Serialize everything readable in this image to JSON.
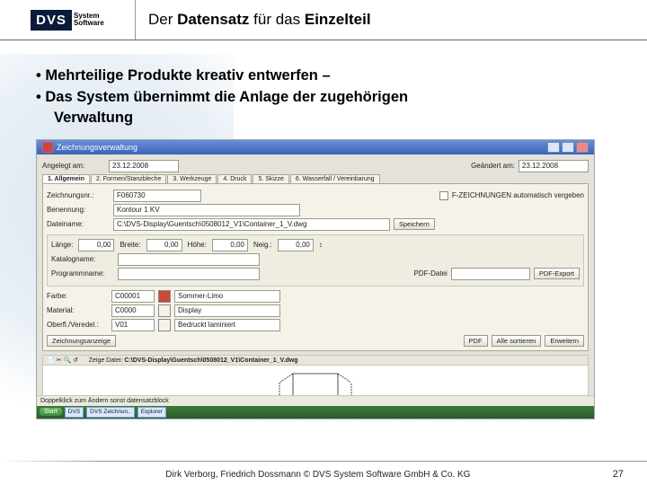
{
  "logo": {
    "brand": "DVS",
    "sub1": "System",
    "sub2": "Software"
  },
  "slide": {
    "title_pre": "Der ",
    "title_bold": "Datensatz",
    "title_post": " für das ",
    "title_bold2": "Einzelteil"
  },
  "bullets": {
    "b1": "Mehrteilige Produkte kreativ entwerfen –",
    "b2": "Das System übernimmt die Anlage der zugehörigen",
    "b3": "Verwaltung"
  },
  "app": {
    "title": "Zeichnungsverwaltung",
    "date_label": "Angelegt am:",
    "angelegt_value": "23.12.2008",
    "geaendert_label": "Geändert am:",
    "geaendert_value": "23.12.2008",
    "tabs": {
      "t1": "1. Allgemein",
      "t2": "2. Formen/Stanzbleche",
      "t3": "3. Werkzeuge",
      "t4": "4. Druck",
      "t5": "5. Skizze",
      "t6": "6. Wasserfall / Vereinbarung"
    },
    "zeichnungsnr_lbl": "Zeichnungsnr.:",
    "zeichnungsnr_val": "F060730",
    "autovergabe": "F-ZEICHNUNGEN automatisch vergeben",
    "benennung_lbl": "Benennung:",
    "benennung_val": "Kontour 1 KV",
    "dateiname_lbl": "Dateiname:",
    "dateiname_val": "C:\\DVS-Display\\Guentsch\\0508012_V1\\Container_1_V.dwg",
    "savebtn": "Speichern",
    "laenge_lbl": "Länge:",
    "laenge_val": "0,00",
    "breite_lbl": "Breite:",
    "breite_val": "0,00",
    "hoehe_lbl": "Höhe:",
    "hoehe_val": "0,00",
    "neig_lbl": "Neig.:",
    "neig_val": "0,00",
    "pfeil": "↕",
    "katalogname_lbl": "Katalogname:",
    "programmname_lbl": "Programmname:",
    "pdfbtn": "PDF-Datei",
    "pdfbtn2": "PDF-Export",
    "farbe_lbl": "Farbe:",
    "farbe_val": "C00001",
    "farbe_col": "#c84a38",
    "farbe_name": "Sommer-Limo",
    "material_lbl": "Material:",
    "material_val": "C0000",
    "material_col": "#fff",
    "material_name": "Display",
    "oberfl_lbl": "Oberfl./Veredel.:",
    "oberfl_val": "V01",
    "oberfl_col": "#fff",
    "oberfl_name": "Bedruckt laminiert",
    "btn1": "Zeichnungsanzeige",
    "btn2": "PDF",
    "btn3": "Alle sortieren",
    "btn4": "Erweitern",
    "toolbar": {
      "i1": "📄",
      "i2": "✂",
      "i3": "🔍",
      "i4": "↺"
    },
    "preview_label_pre": "Zeige Datei: ",
    "preview_path": "C:\\DVS-Display\\Guentsch\\0508012_V1\\Container_1_V.dwg",
    "status": "Doppelklick zum Ändern sonst datensatzblock",
    "taskbar": {
      "start": "Start",
      "t1": "DVS",
      "t2": "DVS Zeichnun..",
      "t3": "Explorer"
    }
  },
  "footer": {
    "credit": "Dirk Verborg, Friedrich Dossmann © DVS System Software GmbH & Co. KG",
    "page": "27"
  }
}
